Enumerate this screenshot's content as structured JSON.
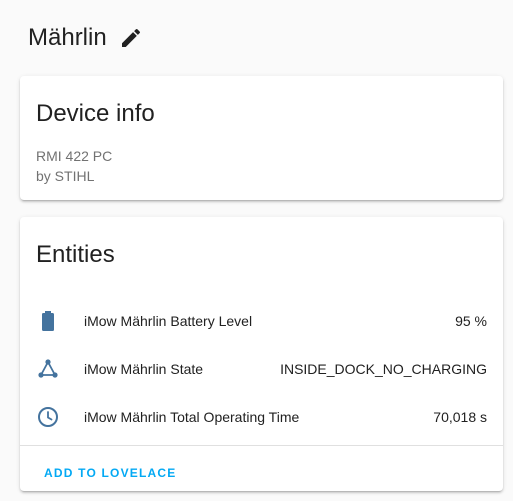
{
  "header": {
    "title": "Mährlin",
    "edit_icon": "pencil-icon"
  },
  "device_info": {
    "title": "Device info",
    "model": "RMI 422 PC",
    "manufacturer": "by STIHL"
  },
  "entities": {
    "title": "Entities",
    "items": [
      {
        "icon": "battery-icon",
        "name": "iMow Mährlin Battery Level",
        "state": "95 %"
      },
      {
        "icon": "graph-icon",
        "name": "iMow Mährlin State",
        "state": "INSIDE_DOCK_NO_CHARGING"
      },
      {
        "icon": "clock-icon",
        "name": "iMow Mährlin Total Operating Time",
        "state": "70,018 s"
      }
    ],
    "action_label": "ADD TO LOVELACE"
  },
  "colors": {
    "icon": "#44739e",
    "accent": "#03a9f4",
    "secondary_text": "#727272",
    "background": "#fafafa"
  }
}
